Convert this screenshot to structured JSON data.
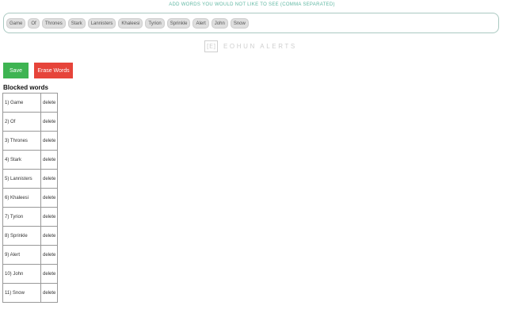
{
  "instruction": "ADD WORDS YOU WOULD NOT LIKE TO SEE (COMMA SEPARATED)",
  "tags": [
    "Game",
    "Of",
    "Thrones",
    "Stark",
    "Lannisters",
    "Khaleesi",
    "Tyrion",
    "Sprinkle",
    "Alert",
    "John",
    "Snow"
  ],
  "logo": {
    "mark": "[E]",
    "text": "EOHUN ALERTS"
  },
  "buttons": {
    "save": "Save",
    "erase": "Erase Words"
  },
  "list_heading": "Blocked words",
  "blocked_words": [
    {
      "label": "1) Game",
      "action": "delete"
    },
    {
      "label": "2) Of",
      "action": "delete"
    },
    {
      "label": "3) Thrones",
      "action": "delete"
    },
    {
      "label": "4) Stark",
      "action": "delete"
    },
    {
      "label": "5) Lannisters",
      "action": "delete"
    },
    {
      "label": "6) Khaleesi",
      "action": "delete"
    },
    {
      "label": "7) Tyrion",
      "action": "delete"
    },
    {
      "label": "8) Sprinkle",
      "action": "delete"
    },
    {
      "label": "9) Alert",
      "action": "delete"
    },
    {
      "label": "10) John",
      "action": "delete"
    },
    {
      "label": "11) Snow",
      "action": "delete"
    }
  ],
  "colors": {
    "save": "#3eb452",
    "erase": "#e6443a",
    "instruction": "#5fb7a2"
  }
}
